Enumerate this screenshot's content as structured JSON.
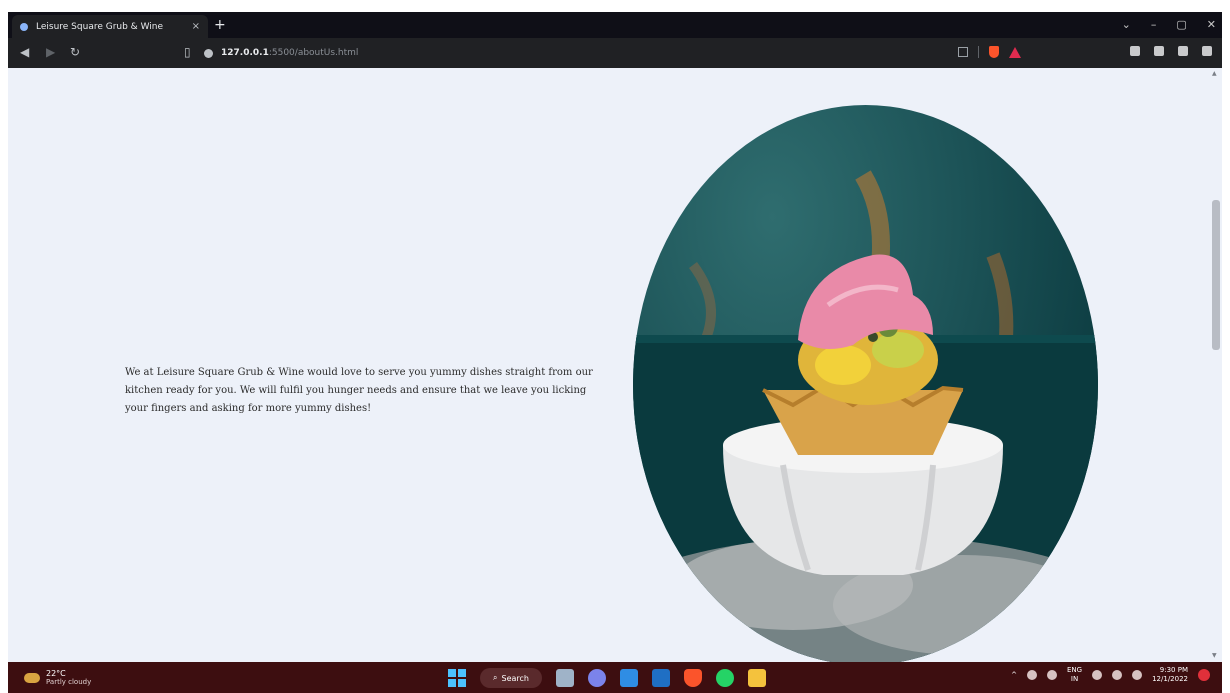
{
  "browser": {
    "tab_title": "Leisure Square Grub & Wine",
    "tab_close": "×",
    "new_tab": "+",
    "url_host": "127.0.0.1",
    "url_path": ":5500/aboutUs.html",
    "window_controls": [
      "⌄",
      "–",
      "▢",
      "✕"
    ]
  },
  "page": {
    "intro_text": "We at Leisure Square Grub & Wine would love to serve you yummy dishes straight from our kitchen ready for you. We will fulfil you hunger needs and ensure that we leave you licking your fingers and asking for more yummy dishes!",
    "hero_image": "dessert-on-smoking-bowl"
  },
  "taskbar": {
    "weather_temp": "22°C",
    "weather_desc": "Partly cloudy",
    "search_label": "Search",
    "lang_top": "ENG",
    "lang_bottom": "IN",
    "time": "9:30 PM",
    "date": "12/1/2022",
    "apps": [
      "file-explorer-icon",
      "chat-icon",
      "vscode-icon",
      "mail-icon",
      "brave-icon",
      "whatsapp-icon",
      "folder-icon"
    ]
  },
  "colors": {
    "page_bg": "#edf1f9",
    "taskbar_bg": "#3d0e10",
    "chrome_bg": "#202124"
  }
}
